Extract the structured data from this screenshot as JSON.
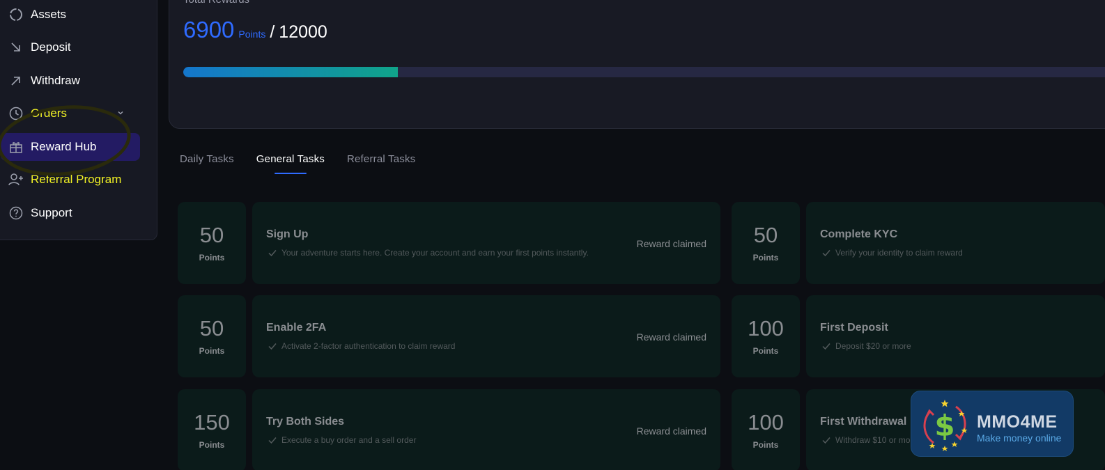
{
  "sidebar": {
    "items": [
      {
        "label": "Assets",
        "icon": "assets-icon"
      },
      {
        "label": "Deposit",
        "icon": "deposit-arrow-icon"
      },
      {
        "label": "Withdraw",
        "icon": "withdraw-arrow-icon"
      },
      {
        "label": "Orders",
        "icon": "clock-icon"
      },
      {
        "label": "Reward Hub",
        "icon": "gift-icon"
      },
      {
        "label": "Referral Program",
        "icon": "add-user-icon"
      },
      {
        "label": "Support",
        "icon": "help-icon"
      }
    ]
  },
  "rewards": {
    "title": "Total Rewards",
    "current": "6900",
    "unit": "Points",
    "separator": "/",
    "total": "12000",
    "progress_fraction": 0.575
  },
  "tabs": [
    {
      "label": "Daily Tasks"
    },
    {
      "label": "General Tasks"
    },
    {
      "label": "Referral Tasks"
    }
  ],
  "tasks": [
    {
      "points": "50",
      "unit": "Points",
      "title": "Sign Up",
      "desc": "Your adventure starts here. Create your account and earn your first points instantly.",
      "status": "Reward claimed"
    },
    {
      "points": "50",
      "unit": "Points",
      "title": "Complete KYC",
      "desc": "Verify your identity to claim reward",
      "status": ""
    },
    {
      "points": "50",
      "unit": "Points",
      "title": "Enable 2FA",
      "desc": "Activate 2-factor authentication to claim reward",
      "status": "Reward claimed"
    },
    {
      "points": "100",
      "unit": "Points",
      "title": "First Deposit",
      "desc": "Deposit $20 or more",
      "status": ""
    },
    {
      "points": "150",
      "unit": "Points",
      "title": "Try Both Sides",
      "desc": "Execute a buy order and a sell order",
      "status": "Reward claimed"
    },
    {
      "points": "100",
      "unit": "Points",
      "title": "First Withdrawal",
      "desc": "Withdraw $10 or mo",
      "status": ""
    }
  ],
  "watermark": {
    "name": "MMO4ME",
    "tagline": "Make money online"
  },
  "colors": {
    "accent": "#2f6bff",
    "highlight": "#f2f224",
    "active_nav": "#231b63",
    "card_bg": "#0b1b1a"
  }
}
